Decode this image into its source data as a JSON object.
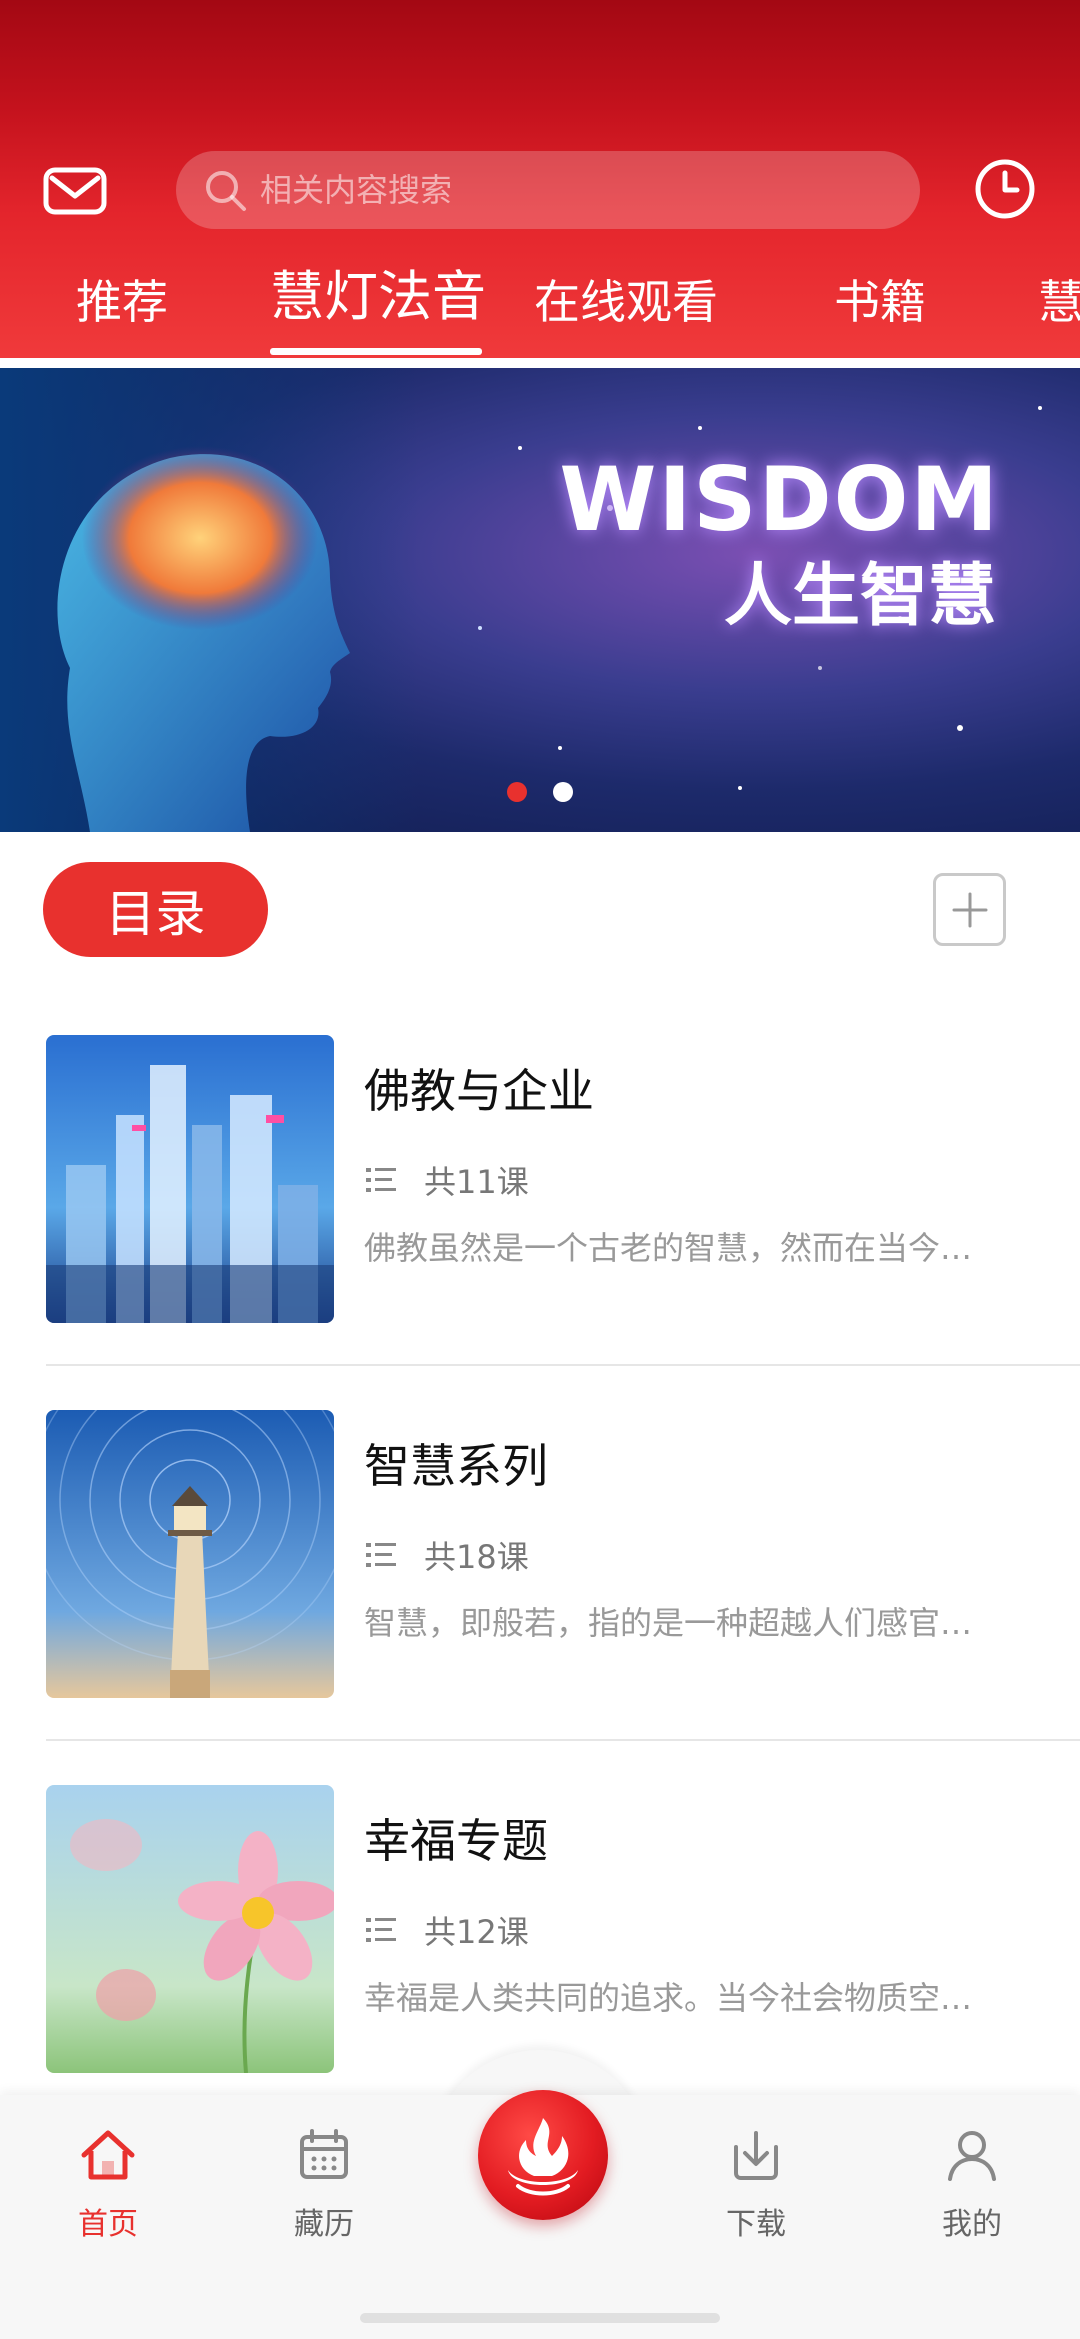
{
  "header": {
    "search_placeholder": "相关内容搜索",
    "tabs": [
      {
        "label": "推荐"
      },
      {
        "label": "慧灯法音"
      },
      {
        "label": "在线观看"
      },
      {
        "label": "书籍"
      },
      {
        "label": "慧"
      }
    ],
    "active_tab": "慧灯法音",
    "left_icon": "mail-icon",
    "right_icon": "clock-icon"
  },
  "banner": {
    "title": "WISDOM",
    "subtitle": "人生智慧",
    "page_count": 2,
    "active_page": 1
  },
  "catalog": {
    "label": "目录",
    "add_icon": "plus-icon"
  },
  "courses": [
    {
      "title": "佛教与企业",
      "count": "共11课",
      "description": "佛教虽然是一个古老的智慧，然而在当今…",
      "thumb_icon": "city-skyline-image"
    },
    {
      "title": "智慧系列",
      "count": "共18课",
      "description": "智慧，即般若，指的是一种超越人们感官…",
      "thumb_icon": "lighthouse-image"
    },
    {
      "title": "幸福专题",
      "count": "共12课",
      "description": "幸福是人类共同的追求。当今社会物质空…",
      "thumb_icon": "flower-image"
    }
  ],
  "nav": {
    "items": [
      {
        "label": "首页",
        "icon": "home-icon"
      },
      {
        "label": "藏历",
        "icon": "calendar-icon"
      },
      {
        "label": "下载",
        "icon": "download-icon"
      },
      {
        "label": "我的",
        "icon": "user-icon"
      }
    ],
    "active": "首页",
    "center_icon": "flame-lotus-logo-icon"
  },
  "colors": {
    "brand_red": "#e8312e",
    "header_dark": "#a30813",
    "active_nav": "#e8312e",
    "inactive_text": "#666666"
  }
}
